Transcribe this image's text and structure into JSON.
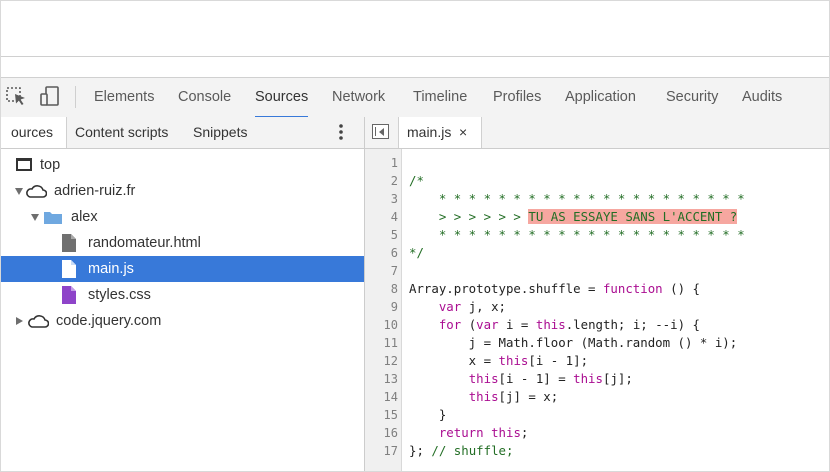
{
  "toolbar": {
    "tabs": [
      {
        "label": "Elements",
        "active": false
      },
      {
        "label": "Console",
        "active": false
      },
      {
        "label": "Sources",
        "active": true
      },
      {
        "label": "Network",
        "active": false
      },
      {
        "label": "Timeline",
        "active": false
      },
      {
        "label": "Profiles",
        "active": false
      },
      {
        "label": "Application",
        "active": false
      },
      {
        "label": "Security",
        "active": false
      },
      {
        "label": "Audits",
        "active": false
      }
    ],
    "icons": [
      "inspect-element-icon",
      "device-mode-icon"
    ],
    "accent_color": "#3879d9"
  },
  "navigator": {
    "tabs": [
      {
        "label": "ources",
        "active": true
      },
      {
        "label": "Content scripts",
        "active": false
      },
      {
        "label": "Snippets",
        "active": false
      }
    ],
    "menu_icon": "more-vertical-icon",
    "tree": [
      {
        "label": "top",
        "icon": "frame-icon",
        "expanded": null,
        "selected": false
      },
      {
        "label": "adrien-ruiz.fr",
        "icon": "cloud-icon",
        "expanded": true,
        "selected": false
      },
      {
        "label": "alex",
        "icon": "folder-icon",
        "expanded": true,
        "selected": false
      },
      {
        "label": "randomateur.html",
        "icon": "document-icon",
        "selected": false
      },
      {
        "label": "main.js",
        "icon": "script-icon",
        "selected": true
      },
      {
        "label": "styles.css",
        "icon": "stylesheet-icon",
        "selected": false
      },
      {
        "label": "code.jquery.com",
        "icon": "cloud-icon",
        "expanded": false,
        "selected": false
      }
    ],
    "selection_color": "#3879d9"
  },
  "editor": {
    "toggle_icon": "toggle-navigator-icon",
    "open_file": {
      "name": "main.js",
      "close_glyph": "×"
    },
    "lines": [
      {
        "n": "1",
        "tokens": []
      },
      {
        "n": "2",
        "tokens": [
          {
            "t": "/*",
            "c": "comment"
          }
        ]
      },
      {
        "n": "3",
        "tokens": [
          {
            "t": "    * * * * * * * * * * * * * * * * * * * * *",
            "c": "comment"
          }
        ]
      },
      {
        "n": "4",
        "tokens": [
          {
            "t": "    > > > > > > ",
            "c": "comment"
          },
          {
            "t": "TU AS ESSAYE SANS L'ACCENT ?",
            "c": "highlight"
          }
        ]
      },
      {
        "n": "5",
        "tokens": [
          {
            "t": "    * * * * * * * * * * * * * * * * * * * * *",
            "c": "comment"
          }
        ]
      },
      {
        "n": "6",
        "tokens": [
          {
            "t": "*/",
            "c": "comment"
          }
        ]
      },
      {
        "n": "7",
        "tokens": []
      },
      {
        "n": "8",
        "tokens": [
          {
            "t": "Array.prototype.shuffle = ",
            "c": "plain"
          },
          {
            "t": "function",
            "c": "kw"
          },
          {
            "t": " () {",
            "c": "plain"
          }
        ]
      },
      {
        "n": "9",
        "tokens": [
          {
            "t": "    ",
            "c": "plain"
          },
          {
            "t": "var",
            "c": "kw"
          },
          {
            "t": " j, x;",
            "c": "plain"
          }
        ]
      },
      {
        "n": "10",
        "tokens": [
          {
            "t": "    ",
            "c": "plain"
          },
          {
            "t": "for",
            "c": "kw"
          },
          {
            "t": " (",
            "c": "plain"
          },
          {
            "t": "var",
            "c": "kw"
          },
          {
            "t": " i = ",
            "c": "plain"
          },
          {
            "t": "this",
            "c": "kw"
          },
          {
            "t": ".length; i; --i) {",
            "c": "plain"
          }
        ]
      },
      {
        "n": "11",
        "tokens": [
          {
            "t": "        j = Math.floor (Math.random () * i);",
            "c": "plain"
          }
        ]
      },
      {
        "n": "12",
        "tokens": [
          {
            "t": "        x = ",
            "c": "plain"
          },
          {
            "t": "this",
            "c": "kw"
          },
          {
            "t": "[i - 1];",
            "c": "plain"
          }
        ]
      },
      {
        "n": "13",
        "tokens": [
          {
            "t": "        ",
            "c": "plain"
          },
          {
            "t": "this",
            "c": "kw"
          },
          {
            "t": "[i - 1] = ",
            "c": "plain"
          },
          {
            "t": "this",
            "c": "kw"
          },
          {
            "t": "[j];",
            "c": "plain"
          }
        ]
      },
      {
        "n": "14",
        "tokens": [
          {
            "t": "        ",
            "c": "plain"
          },
          {
            "t": "this",
            "c": "kw"
          },
          {
            "t": "[j] = x;",
            "c": "plain"
          }
        ]
      },
      {
        "n": "15",
        "tokens": [
          {
            "t": "    }",
            "c": "plain"
          }
        ]
      },
      {
        "n": "16",
        "tokens": [
          {
            "t": "    ",
            "c": "plain"
          },
          {
            "t": "return",
            "c": "kw"
          },
          {
            "t": " ",
            "c": "plain"
          },
          {
            "t": "this",
            "c": "kw"
          },
          {
            "t": ";",
            "c": "plain"
          }
        ]
      },
      {
        "n": "17",
        "tokens": [
          {
            "t": "}; ",
            "c": "plain"
          },
          {
            "t": "// shuffle;",
            "c": "comment"
          }
        ]
      }
    ],
    "colors": {
      "comment": "#236e25",
      "keyword": "#aa0d91",
      "highlight_bg": "#f6a7a0"
    }
  }
}
